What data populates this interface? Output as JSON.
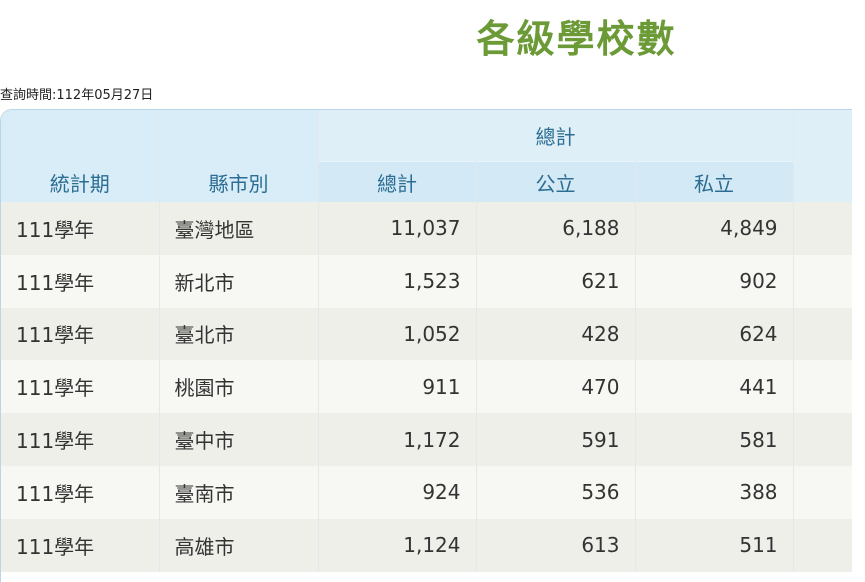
{
  "page": {
    "title": "各級學校數",
    "query_time": "查詢時間:112年05月27日"
  },
  "table": {
    "headers": {
      "period": "統計期",
      "county": "縣市別",
      "group_total": "總計",
      "total": "總計",
      "public": "公立",
      "private": "私立"
    },
    "rows": [
      {
        "period": "111學年",
        "county": "臺灣地區",
        "total": "11,037",
        "public": "6,188",
        "private": "4,849"
      },
      {
        "period": "111學年",
        "county": "新北市",
        "total": "1,523",
        "public": "621",
        "private": "902"
      },
      {
        "period": "111學年",
        "county": "臺北市",
        "total": "1,052",
        "public": "428",
        "private": "624"
      },
      {
        "period": "111學年",
        "county": "桃園市",
        "total": "911",
        "public": "470",
        "private": "441"
      },
      {
        "period": "111學年",
        "county": "臺中市",
        "total": "1,172",
        "public": "591",
        "private": "581"
      },
      {
        "period": "111學年",
        "county": "臺南市",
        "total": "924",
        "public": "536",
        "private": "388"
      },
      {
        "period": "111學年",
        "county": "高雄市",
        "total": "1,124",
        "public": "613",
        "private": "511"
      }
    ]
  },
  "colors": {
    "title": "#6b9a37",
    "header_bg": "#d8edf8",
    "header_text": "#2b6d93",
    "row_odd": "#efefea",
    "row_even": "#f7f7f3"
  }
}
